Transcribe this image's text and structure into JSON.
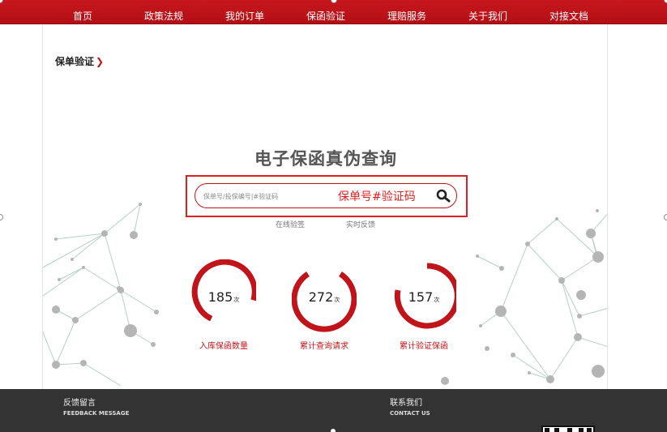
{
  "nav": {
    "items": [
      {
        "label": "首页"
      },
      {
        "label": "政策法规"
      },
      {
        "label": "我的订单"
      },
      {
        "label": "保函验证"
      },
      {
        "label": "理赔服务"
      },
      {
        "label": "关于我们"
      },
      {
        "label": "对接文档"
      }
    ]
  },
  "breadcrumb": {
    "label": "保单验证",
    "arrow": "❯"
  },
  "main": {
    "heading": "电子保函真伪查询",
    "search": {
      "placeholder": "保单号/投保编号|#验证码",
      "annotation": "保单号#验证码",
      "icon": "search-icon"
    },
    "links": {
      "online_check": "在线验签",
      "feedback": "实时反馈"
    }
  },
  "stats": [
    {
      "value": "185",
      "unit": "次",
      "label": "入库保函数量"
    },
    {
      "value": "272",
      "unit": "次",
      "label": "累计查询请求"
    },
    {
      "value": "157",
      "unit": "次",
      "label": "累计验证保函"
    }
  ],
  "footer": {
    "feedback_title": "反馈留言",
    "feedback_sub": "FEEDBACK MESSAGE",
    "contact_title": "联系我们",
    "contact_sub": "CONTACT US"
  },
  "colors": {
    "brand_red": "#c0141a",
    "footer_bg": "#333333",
    "annotation_red": "#e02020"
  }
}
